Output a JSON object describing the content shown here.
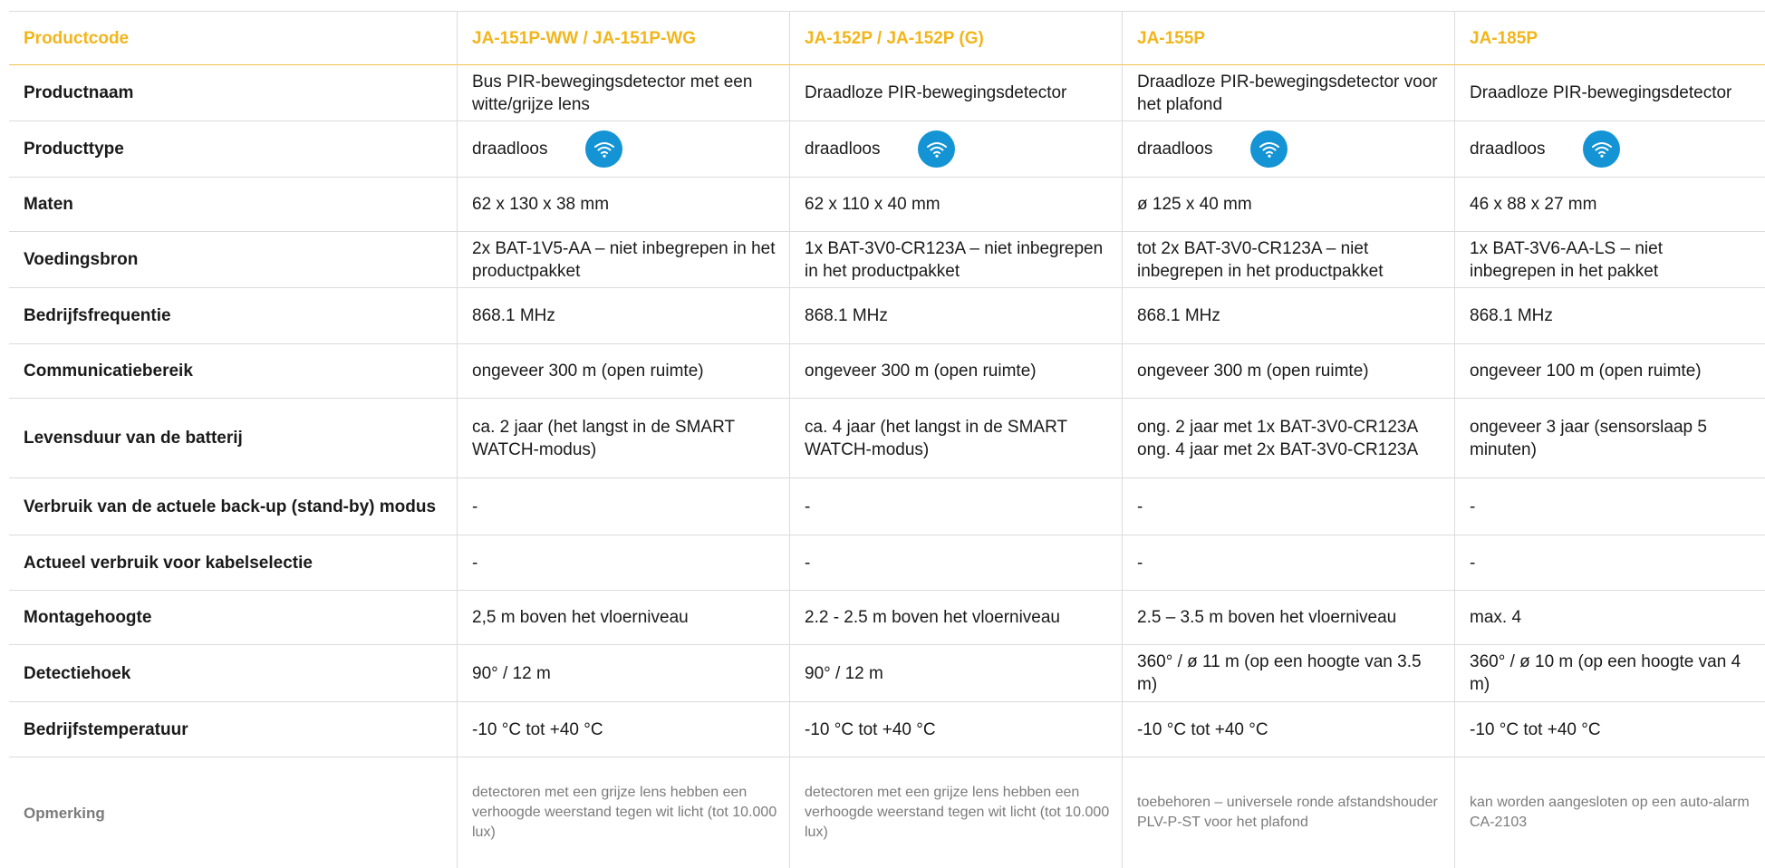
{
  "colors": {
    "accent": "#f2b51b",
    "wifi_badge": "#1494d4",
    "note_text": "#7b7b7b"
  },
  "header": {
    "label": "Productcode",
    "products": [
      "JA-151P-WW / JA-151P-WG",
      "JA-152P / JA-152P (G)",
      "JA-155P",
      "JA-185P"
    ]
  },
  "rows": [
    {
      "label": "Productnaam",
      "values": [
        "Bus PIR-bewegingsdetector met een witte/grijze lens",
        "Draadloze PIR-bewegingsdetector",
        "Draadloze PIR-bewegingsdetector voor het plafond",
        "Draadloze PIR-bewegingsdetector"
      ]
    },
    {
      "label": "Producttype",
      "values": [
        "draadloos",
        "draadloos",
        "draadloos",
        "draadloos"
      ],
      "icon": "wifi-icon"
    },
    {
      "label": "Maten",
      "values": [
        "62 x 130 x 38 mm",
        "62 x 110 x 40 mm",
        "ø 125 x 40 mm",
        "46 x 88 x 27 mm"
      ]
    },
    {
      "label": "Voedingsbron",
      "values": [
        "2x BAT-1V5-AA – niet inbegrepen in het productpakket",
        "1x BAT-3V0-CR123A – niet inbegrepen in het productpakket",
        "tot 2x BAT-3V0-CR123A – niet inbegrepen in het productpakket",
        "1x BAT-3V6-AA-LS – niet inbegrepen in het pakket"
      ]
    },
    {
      "label": "Bedrijfsfrequentie",
      "values": [
        "868.1 MHz",
        "868.1 MHz",
        "868.1 MHz",
        "868.1 MHz"
      ]
    },
    {
      "label": "Communicatiebereik",
      "values": [
        "ongeveer 300 m (open ruimte)",
        "ongeveer 300 m (open ruimte)",
        "ongeveer 300 m (open ruimte)",
        "ongeveer 100 m (open ruimte)"
      ]
    },
    {
      "label": "Levensduur van de batterij",
      "values": [
        "ca. 2 jaar (het langst in de SMART WATCH-modus)",
        "ca. 4 jaar (het langst in de SMART WATCH-modus)",
        "ong. 2 jaar met 1x BAT-3V0-CR123A ong. 4 jaar met 2x BAT-3V0-CR123A",
        "ongeveer 3 jaar (sensorslaap 5 minuten)"
      ]
    },
    {
      "label": "Verbruik van de actuele back-up (stand-by) modus",
      "values": [
        "-",
        "-",
        "-",
        "-"
      ]
    },
    {
      "label": "Actueel verbruik voor kabelselectie",
      "values": [
        "-",
        "-",
        "-",
        "-"
      ]
    },
    {
      "label": "Montagehoogte",
      "values": [
        "2,5 m boven het vloerniveau",
        "2.2 - 2.5 m boven het vloerniveau",
        "2.5 – 3.5 m boven het vloerniveau",
        "max. 4"
      ]
    },
    {
      "label": "Detectiehoek",
      "values": [
        "90° / 12 m",
        "90° / 12 m",
        "360° / ø  11 m (op een hoogte van 3.5 m)",
        "360° / ø 10 m (op een hoogte van 4 m)"
      ]
    },
    {
      "label": "Bedrijfstemperatuur",
      "values": [
        "-10 °C tot +40 °C",
        "-10 °C tot +40 °C",
        "-10 °C tot +40 °C",
        "-10 °C tot +40 °C"
      ]
    },
    {
      "label": "Opmerking",
      "values": [
        "detectoren met een grijze lens hebben een verhoogde weerstand tegen wit licht (tot 10.000 lux)",
        "detectoren met een grijze lens hebben een verhoogde weerstand tegen wit licht (tot 10.000 lux)",
        "toebehoren – universele ronde afstandshouder PLV-P-ST voor het plafond",
        "kan worden aangesloten op een auto-alarm CA-2103"
      ]
    }
  ]
}
